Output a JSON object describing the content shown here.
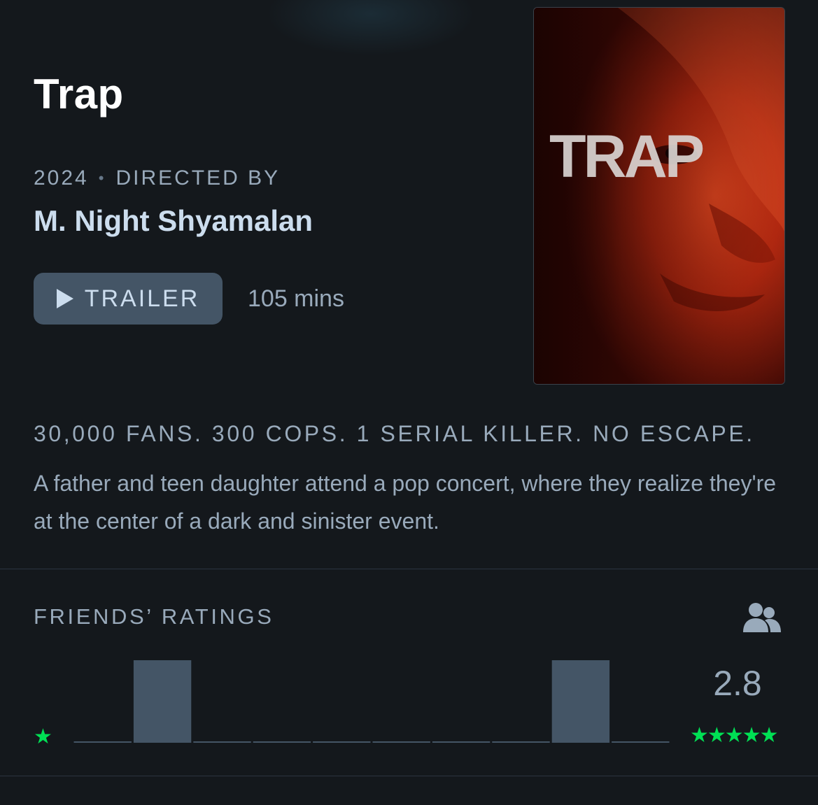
{
  "film": {
    "title": "Trap",
    "year": "2024",
    "separator": "•",
    "directed_by_label": "DIRECTED BY",
    "director": "M. Night Shyamalan",
    "trailer_label": "TRAILER",
    "runtime": "105 mins",
    "tagline": "30,000 FANS. 300 COPS. 1 SERIAL KILLER. NO ESCAPE.",
    "synopsis": "A father and teen daughter attend a pop concert, where they realize they're at the center of a dark and sinister event."
  },
  "poster": {
    "wordmark": "TRAP",
    "accent_color": "#c8301a"
  },
  "ratings": {
    "heading": "FRIENDS’ RATINGS",
    "average": "2.8",
    "min_stars": "★",
    "max_stars": "★★★★★",
    "star_color": "#00e054",
    "bar_color": "#445566",
    "friends_icon": "friends-icon",
    "histogram": [
      0,
      1,
      0,
      0,
      0,
      0,
      0,
      0,
      1,
      0
    ]
  },
  "colors": {
    "background": "#14181c",
    "text_primary": "#ffffff",
    "text_secondary": "#99aabb",
    "button_bg": "#445566"
  }
}
